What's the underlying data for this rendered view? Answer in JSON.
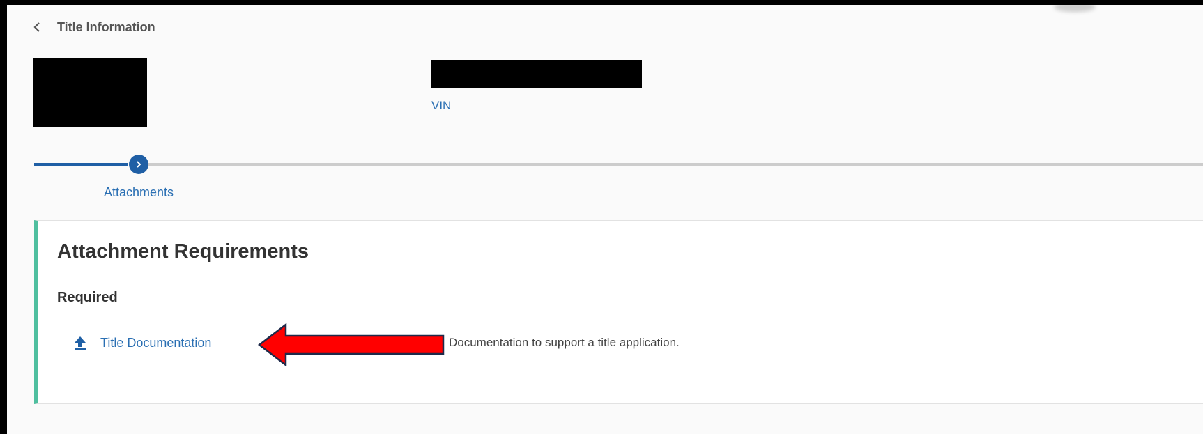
{
  "header": {
    "back_label": "Title Information",
    "back_icon": "chevron-left-icon"
  },
  "vehicle": {
    "vin_label": "VIN"
  },
  "stepper": {
    "steps": [
      {
        "label": "Attachments",
        "icon": "chevron-right-icon"
      }
    ]
  },
  "attachments": {
    "title": "Attachment Requirements",
    "required_label": "Required",
    "items": [
      {
        "label": "Title Documentation",
        "icon": "upload-icon",
        "description": "Documentation to support a title application."
      }
    ]
  },
  "colors": {
    "accent": "#1f5fa5",
    "link": "#2a6fb3",
    "card_border_left": "#4fbf9f",
    "annotation_arrow": "#ff0000"
  }
}
